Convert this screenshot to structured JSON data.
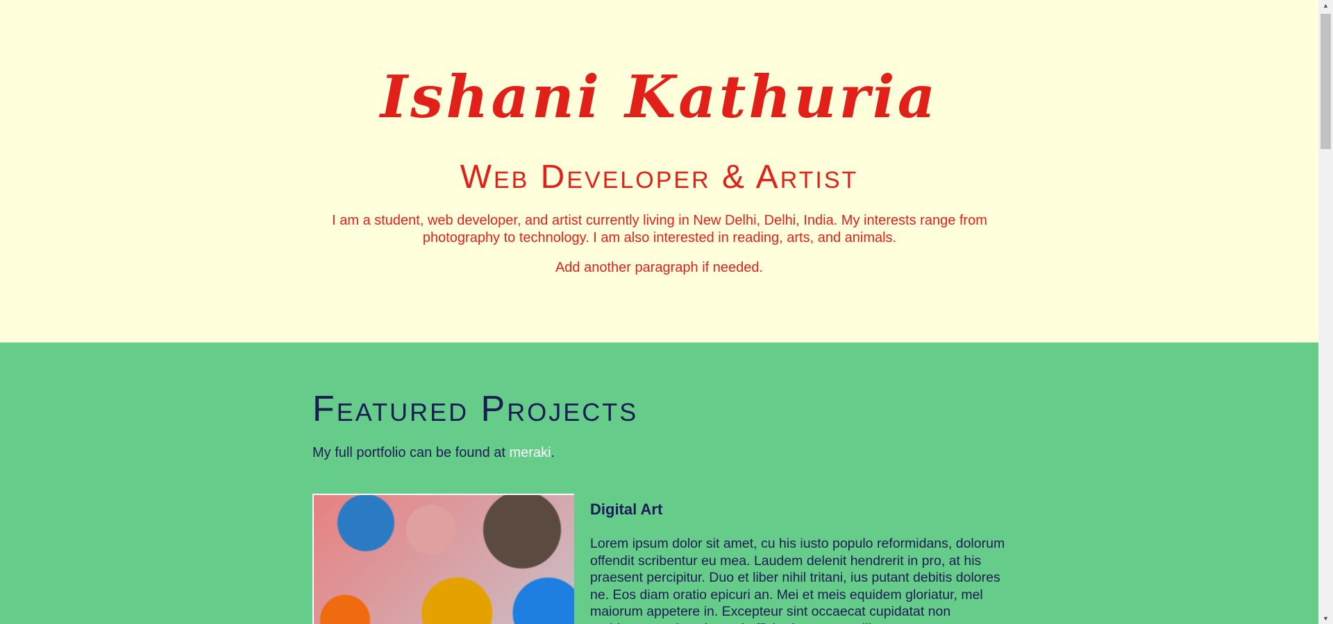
{
  "hero": {
    "name": "Ishani Kathuria",
    "subtitle": "Web Developer & Artist",
    "bio": "I am a student, web developer, and artist currently living in New Delhi, Delhi, India. My interests range from photography to technology. I am also interested in reading, arts, and animals.",
    "extra": "Add another paragraph if needed."
  },
  "projects": {
    "heading": "Featured Projects",
    "lead_prefix": "My full portfolio can be found at ",
    "lead_link": "meraki",
    "lead_suffix": ".",
    "items": [
      {
        "title": "Digital Art",
        "description": "Lorem ipsum dolor sit amet, cu his iusto populo reformidans, dolorum offendit scribentur eu mea. Laudem delenit hendrerit in pro, at his praesent percipitur. Duo et liber nihil tritani, ius putant debitis dolores ne. Eos diam oratio epicuri an. Mei et meis equidem gloriatur, mel maiorum appetere in. Excepteur sint occaecat cupidatat non proident, sunt in culpa qui officia deserunt mollit"
      }
    ]
  },
  "colors": {
    "hero_bg": "#ffffdc",
    "accent": "#e2201a",
    "projects_bg": "#65cd89",
    "projects_text": "#1b1b55"
  }
}
